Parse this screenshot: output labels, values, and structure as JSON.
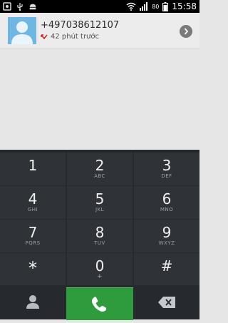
{
  "statusbar": {
    "time": "15:58",
    "battery_label": "80",
    "icons": [
      "screenshot-icon",
      "usb-icon",
      "android-icon",
      "wifi-icon",
      "signal-icon",
      "battery-icon"
    ]
  },
  "recent_call": {
    "number": "+497038612107",
    "time_ago": "42 phút trước",
    "status_icon": "missed-call-icon",
    "missed_color": "#d22222"
  },
  "keypad": {
    "keys": [
      {
        "digit": "1",
        "letters": ""
      },
      {
        "digit": "2",
        "letters": "ABC"
      },
      {
        "digit": "3",
        "letters": "DEF"
      },
      {
        "digit": "4",
        "letters": "GHI"
      },
      {
        "digit": "5",
        "letters": "JKL"
      },
      {
        "digit": "6",
        "letters": "MNO"
      },
      {
        "digit": "7",
        "letters": "PQRS"
      },
      {
        "digit": "8",
        "letters": "TUV"
      },
      {
        "digit": "9",
        "letters": "WXYZ"
      },
      {
        "digit": "*",
        "letters": ""
      },
      {
        "digit": "0",
        "letters": "+"
      },
      {
        "digit": "#",
        "letters": ""
      }
    ],
    "bottom": {
      "contacts_icon": "person-icon",
      "call_icon": "phone-icon",
      "delete_icon": "backspace-icon",
      "call_color": "#2e9b3c"
    }
  }
}
